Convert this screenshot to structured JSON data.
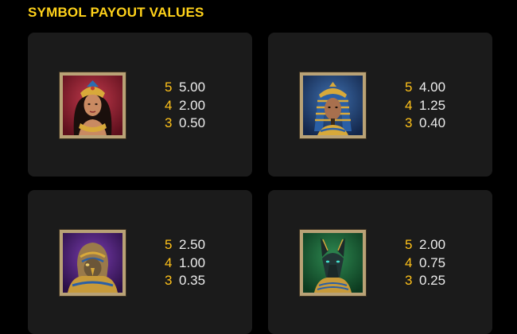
{
  "title": "SYMBOL PAYOUT VALUES",
  "cards": [
    {
      "icon": "cleopatra-queen-icon",
      "accent": "#8a1e2b",
      "payouts": [
        {
          "count": "5",
          "value": "5.00"
        },
        {
          "count": "4",
          "value": "2.00"
        },
        {
          "count": "3",
          "value": "0.50"
        }
      ]
    },
    {
      "icon": "pharaoh-icon",
      "accent": "#20406d",
      "payouts": [
        {
          "count": "5",
          "value": "4.00"
        },
        {
          "count": "4",
          "value": "1.25"
        },
        {
          "count": "3",
          "value": "0.40"
        }
      ]
    },
    {
      "icon": "horus-falcon-icon",
      "accent": "#5d2a8a",
      "payouts": [
        {
          "count": "5",
          "value": "2.50"
        },
        {
          "count": "4",
          "value": "1.00"
        },
        {
          "count": "3",
          "value": "0.35"
        }
      ]
    },
    {
      "icon": "anubis-jackal-icon",
      "accent": "#1e6b3c",
      "payouts": [
        {
          "count": "5",
          "value": "2.00"
        },
        {
          "count": "4",
          "value": "0.75"
        },
        {
          "count": "3",
          "value": "0.25"
        }
      ]
    }
  ]
}
